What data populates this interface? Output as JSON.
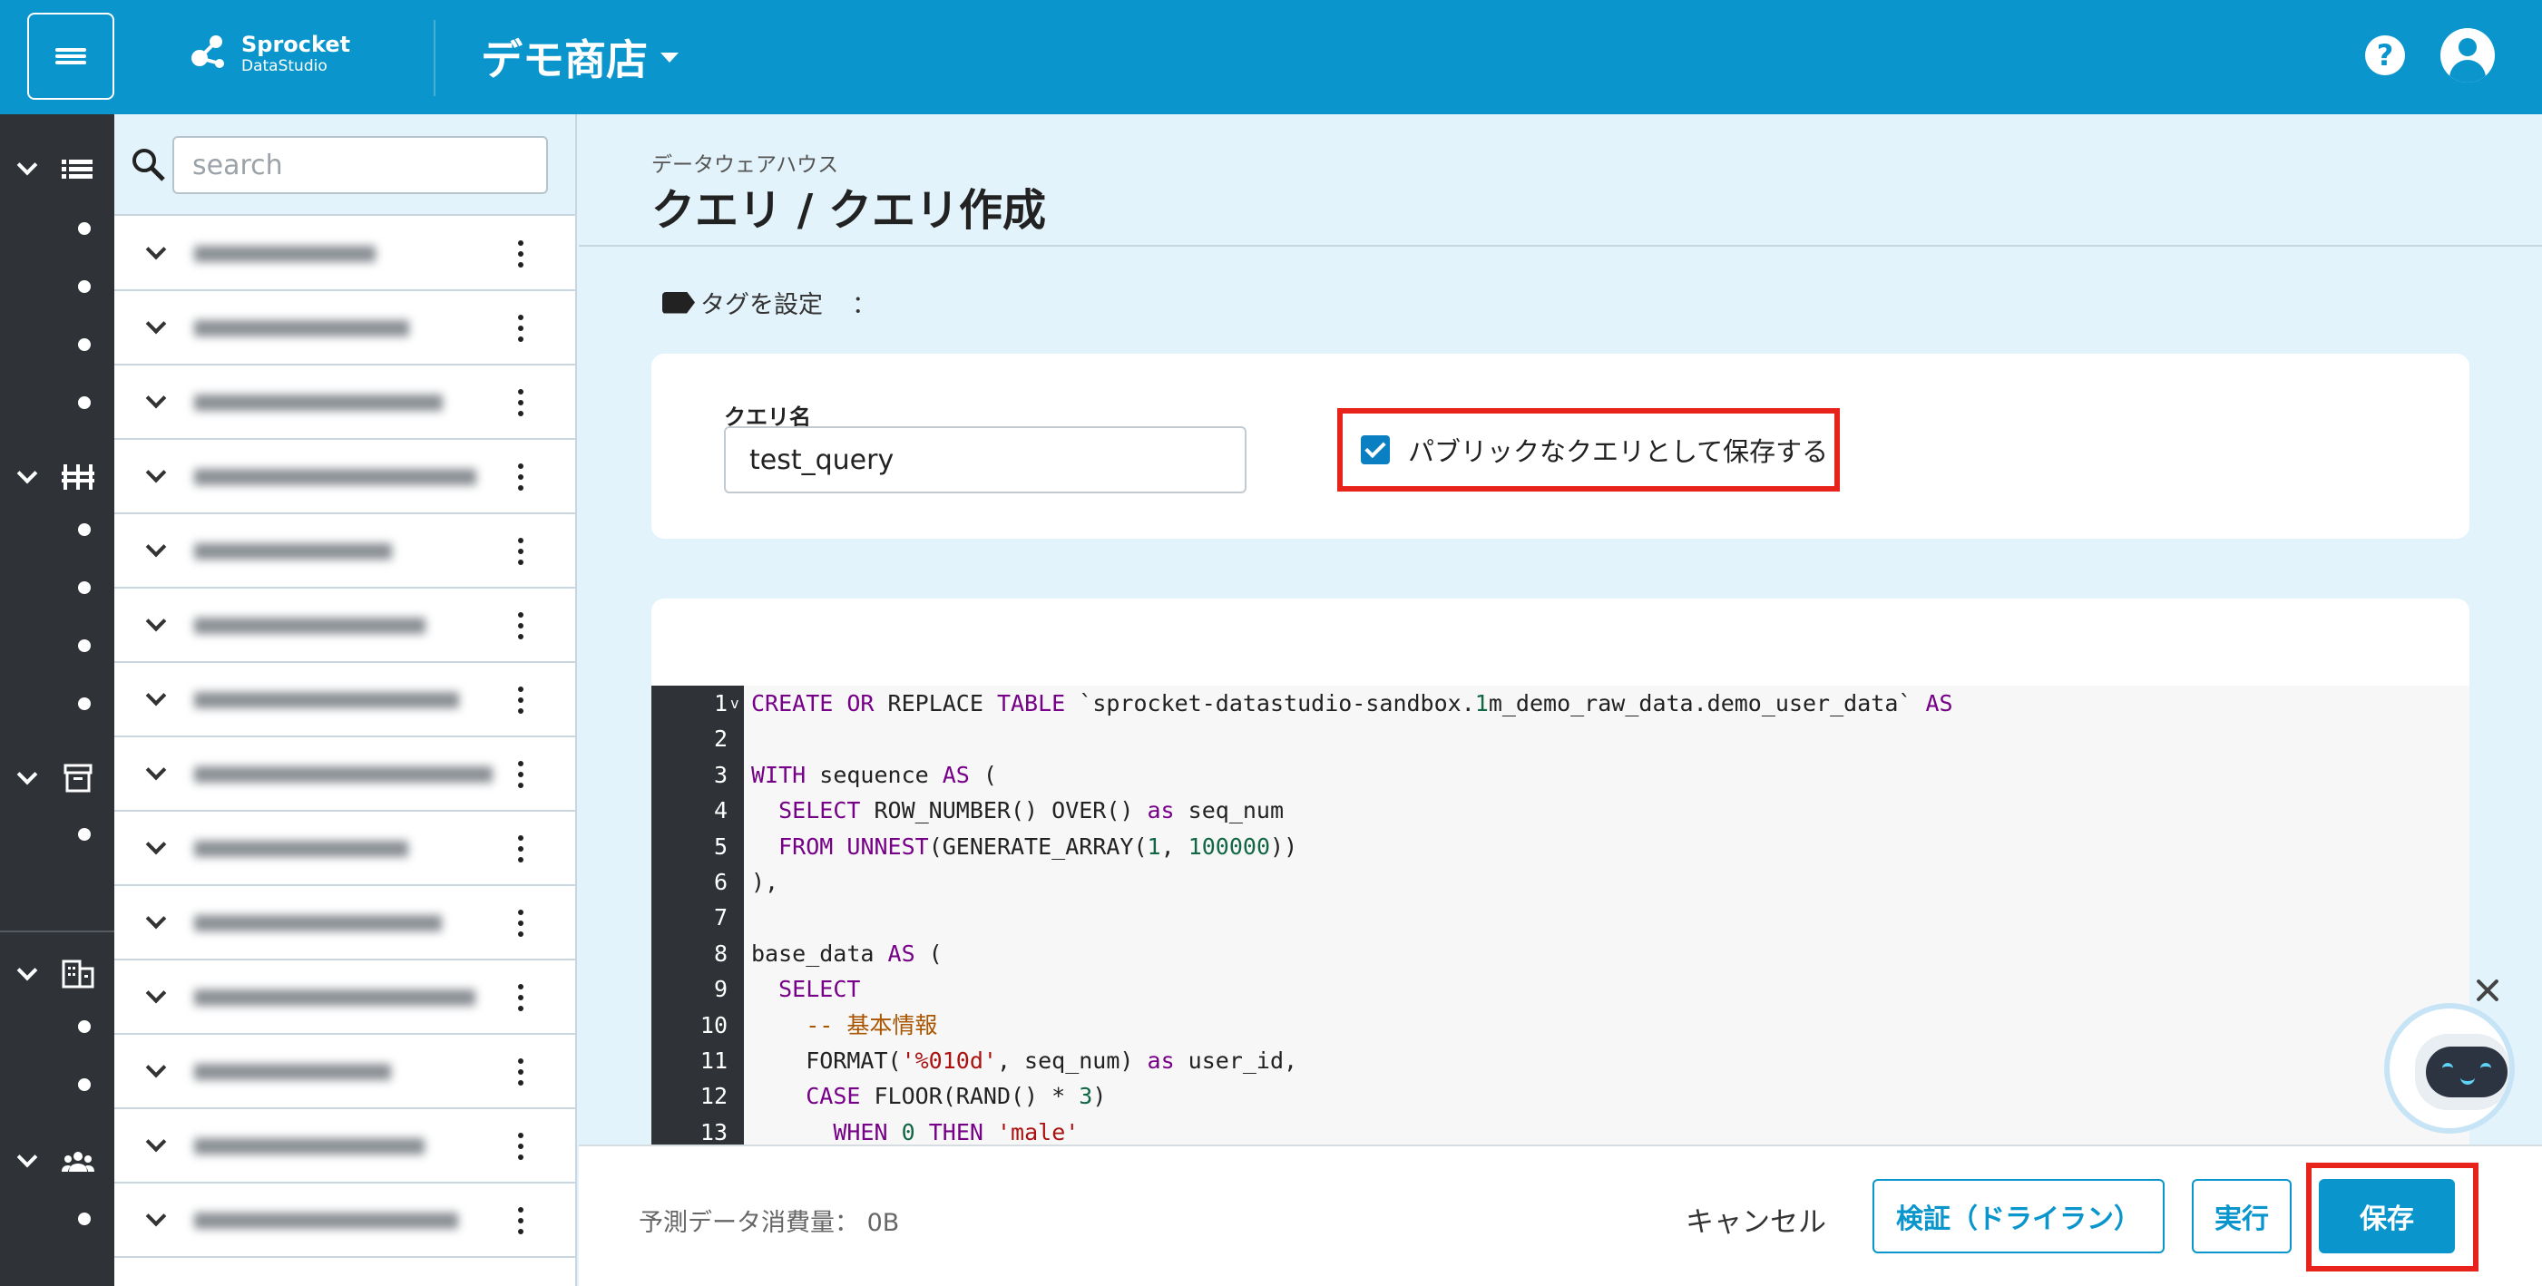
{
  "header": {
    "menu_icon": "hamburger-icon",
    "logo": {
      "name": "Sprocket",
      "sub": "DataStudio"
    },
    "shop_name": "デモ商店",
    "help_icon": "question-circle-icon",
    "user_icon": "account-circle-icon",
    "colors": {
      "brand": "#0a96cd"
    }
  },
  "leftnav": {
    "groups": [
      {
        "icon": "list-icon",
        "items": 4
      },
      {
        "icon": "pipeline-icon",
        "items": 4
      },
      {
        "icon": "archive-icon",
        "items": 1
      },
      {
        "icon": "building-icon",
        "items": 2
      },
      {
        "icon": "people-icon",
        "items": 1
      }
    ]
  },
  "list": {
    "search_placeholder": "search",
    "item_count": 14
  },
  "page": {
    "breadcrumb": "データウェアハウス",
    "title": "クエリ / クエリ作成",
    "tag_label": "タグを設定",
    "tag_colon": "：",
    "query_name_label": "クエリ名",
    "query_name_value": "test_query",
    "public_checkbox_label": "パブリックなクエリとして保存する",
    "public_checked": true,
    "highlight_color": "#e8231b"
  },
  "editor": {
    "lines": [
      {
        "n": "1",
        "html": "<span class=\"kw\">CREATE</span> <span class=\"kw\">OR</span> REPLACE <span class=\"kw\">TABLE</span> `sprocket-datastudio-sandbox.<span class=\"num\">1</span>m_demo_raw_data.demo_user_data` <span class=\"kw\">AS</span>"
      },
      {
        "n": "2",
        "html": ""
      },
      {
        "n": "3",
        "html": "<span class=\"kw\">WITH</span> sequence <span class=\"kw\">AS</span> ("
      },
      {
        "n": "4",
        "html": "  <span class=\"kw\">SELECT</span> ROW_NUMBER() OVER() <span class=\"kw\">as</span> seq_num"
      },
      {
        "n": "5",
        "html": "  <span class=\"kw\">FROM</span> <span class=\"kw\">UNNEST</span>(GENERATE_ARRAY(<span class=\"num\">1</span>, <span class=\"num\">100000</span>))"
      },
      {
        "n": "6",
        "html": "),"
      },
      {
        "n": "7",
        "html": ""
      },
      {
        "n": "8",
        "html": "base_data <span class=\"kw\">AS</span> ("
      },
      {
        "n": "9",
        "html": "  <span class=\"kw\">SELECT</span>"
      },
      {
        "n": "10",
        "html": "    <span class=\"cmt\">-- 基本情報</span>"
      },
      {
        "n": "11",
        "html": "    FORMAT(<span class=\"str\">'%010d'</span>, seq_num) <span class=\"kw\">as</span> user_id,"
      },
      {
        "n": "12",
        "html": "    <span class=\"kw\">CASE</span> FLOOR(RAND() * <span class=\"num\">3</span>)"
      },
      {
        "n": "13",
        "html": "      <span class=\"kw\">WHEN</span> <span class=\"num\">0</span> <span class=\"kw\">THEN</span> <span class=\"str\">'male'</span>"
      }
    ]
  },
  "footer": {
    "estimate": "予測データ消費量：  0B",
    "cancel": "キャンセル",
    "verify": "検証（ドライラン）",
    "run": "実行",
    "save": "保存"
  },
  "bot": {
    "icon": "chatbot-icon",
    "close_icon": "close-icon"
  }
}
